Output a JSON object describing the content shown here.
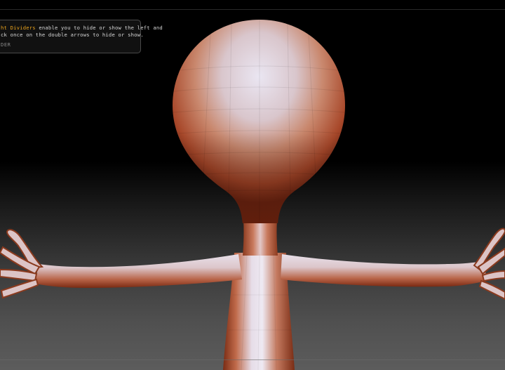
{
  "tooltip": {
    "highlight": "ht Dividers",
    "line1_rest": " enable you to hide or show the left and",
    "line2": "ck once on the double arrows to hide or show.",
    "footer": "DER"
  },
  "scene": {
    "model": "humanoid-sculpt",
    "material_color": "#c8643c",
    "highlight_color": "#e4dfee",
    "background_top": "#000000",
    "background_bottom": "#5c5c5c"
  }
}
